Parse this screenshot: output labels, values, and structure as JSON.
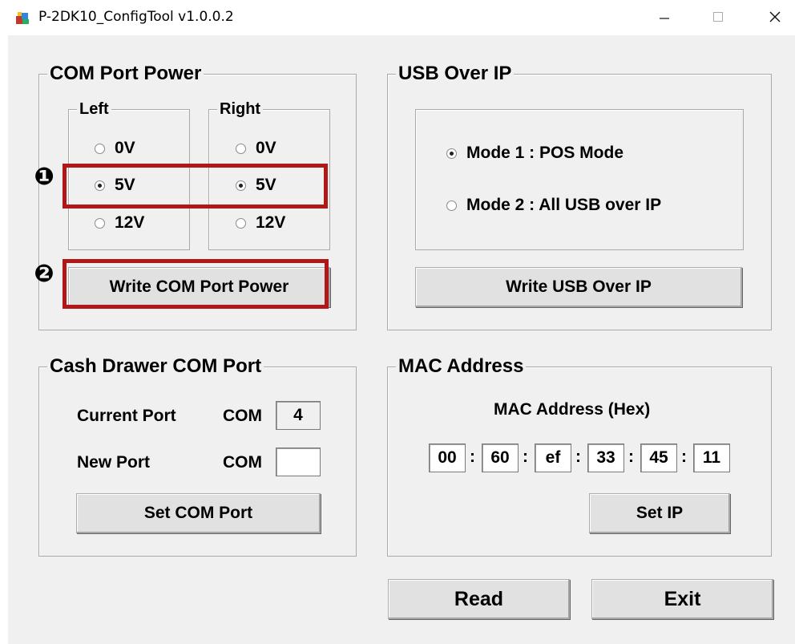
{
  "window": {
    "title": "P-2DK10_ConfigTool v1.0.0.2",
    "minimize_glyph": "—",
    "maximize_glyph": "☐",
    "close_glyph": "✕"
  },
  "com_port_power": {
    "title": "COM Port Power",
    "left": {
      "title": "Left",
      "options": [
        "0V",
        "5V",
        "12V"
      ],
      "selected": "5V"
    },
    "right": {
      "title": "Right",
      "options": [
        "0V",
        "5V",
        "12V"
      ],
      "selected": "5V"
    },
    "write_button": "Write COM Port Power"
  },
  "usb_over_ip": {
    "title": "USB Over IP",
    "options": [
      "Mode 1 : POS Mode",
      "Mode 2 : All USB over IP"
    ],
    "selected": "Mode 1 : POS Mode",
    "write_button": "Write USB Over IP"
  },
  "cash_drawer": {
    "title": "Cash Drawer COM Port",
    "current_port_label": "Current Port",
    "new_port_label": "New Port",
    "com_prefix": "COM",
    "current_port_value": "4",
    "new_port_value": "",
    "set_button": "Set COM Port"
  },
  "mac_address": {
    "title": "MAC Address",
    "subtitle": "MAC Address (Hex)",
    "octets": [
      "00",
      "60",
      "ef",
      "33",
      "45",
      "11"
    ],
    "separator": ":",
    "set_button": "Set IP"
  },
  "footer": {
    "read_button": "Read",
    "exit_button": "Exit"
  },
  "annotations": {
    "marker_1": "❶",
    "marker_2": "❷",
    "highlight_color": "#b01818"
  }
}
